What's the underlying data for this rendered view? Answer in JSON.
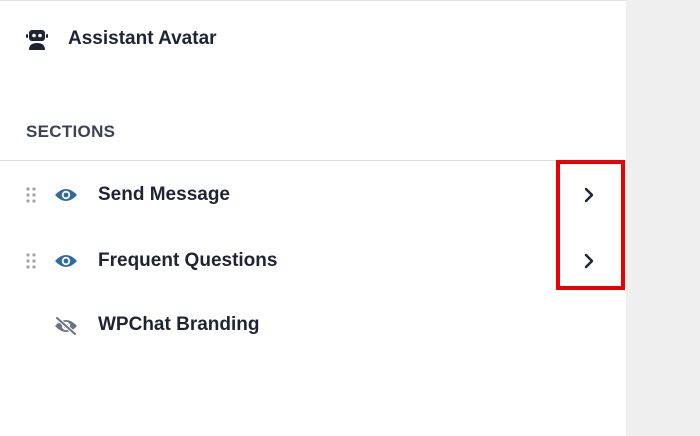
{
  "avatar": {
    "label": "Assistant Avatar",
    "icon": "robot-icon"
  },
  "sections": {
    "heading": "SECTIONS",
    "items": [
      {
        "label": "Send Message",
        "visible": true,
        "draggable": true,
        "expandable": true
      },
      {
        "label": "Frequent Questions",
        "visible": true,
        "draggable": true,
        "expandable": true
      },
      {
        "label": "WPChat Branding",
        "visible": false,
        "draggable": false,
        "expandable": false
      }
    ]
  },
  "colors": {
    "eye_visible": "#2f6a9e",
    "eye_hidden": "#6b7280",
    "highlight": "#ea0000",
    "text": "#1e2433"
  }
}
